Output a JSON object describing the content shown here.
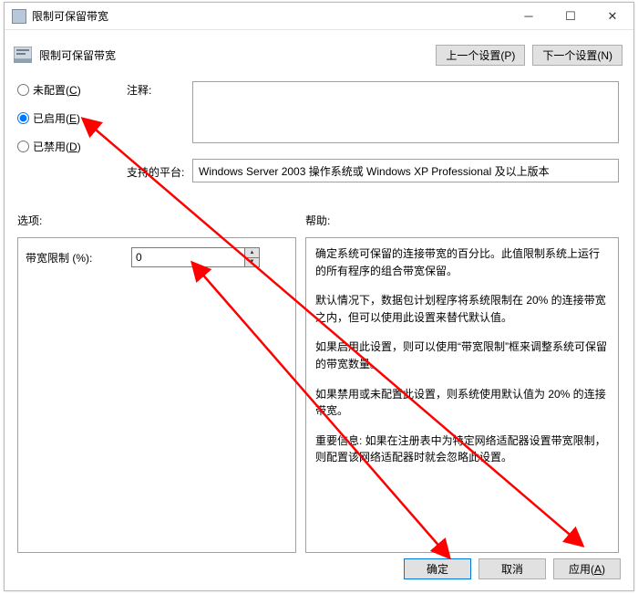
{
  "window": {
    "title": "限制可保留带宽"
  },
  "header": {
    "title": "限制可保留带宽",
    "prev_btn": "上一个设置(P)",
    "next_btn": "下一个设置(N)"
  },
  "radios": {
    "not_configured": {
      "label": "未配置",
      "hotkey": "C",
      "checked": false
    },
    "enabled": {
      "label": "已启用",
      "hotkey": "E",
      "checked": true
    },
    "disabled": {
      "label": "已禁用",
      "hotkey": "D",
      "checked": false
    }
  },
  "labels": {
    "comment": "注释:",
    "supported_platforms": "支持的平台:",
    "options": "选项:",
    "help": "帮助:"
  },
  "comment_value": "",
  "supported_platforms_value": "Windows Server 2003 操作系统或 Windows XP Professional 及以上版本",
  "options": {
    "bandwidth_limit_label": "带宽限制 (%):",
    "bandwidth_limit_value": "0"
  },
  "help": {
    "p1": "确定系统可保留的连接带宽的百分比。此值限制系统上运行的所有程序的组合带宽保留。",
    "p2": "默认情况下，数据包计划程序将系统限制在 20% 的连接带宽之内，但可以使用此设置来替代默认值。",
    "p3": "如果启用此设置，则可以使用“带宽限制”框来调整系统可保留的带宽数量。",
    "p4": "如果禁用或未配置此设置，则系统使用默认值为 20% 的连接带宽。",
    "p5": "重要信息: 如果在注册表中为特定网络适配器设置带宽限制，则配置该网络适配器时就会忽略此设置。"
  },
  "footer": {
    "ok": "确定",
    "cancel": "取消",
    "apply": "应用(A)"
  },
  "arrow_color": "#ff0000"
}
